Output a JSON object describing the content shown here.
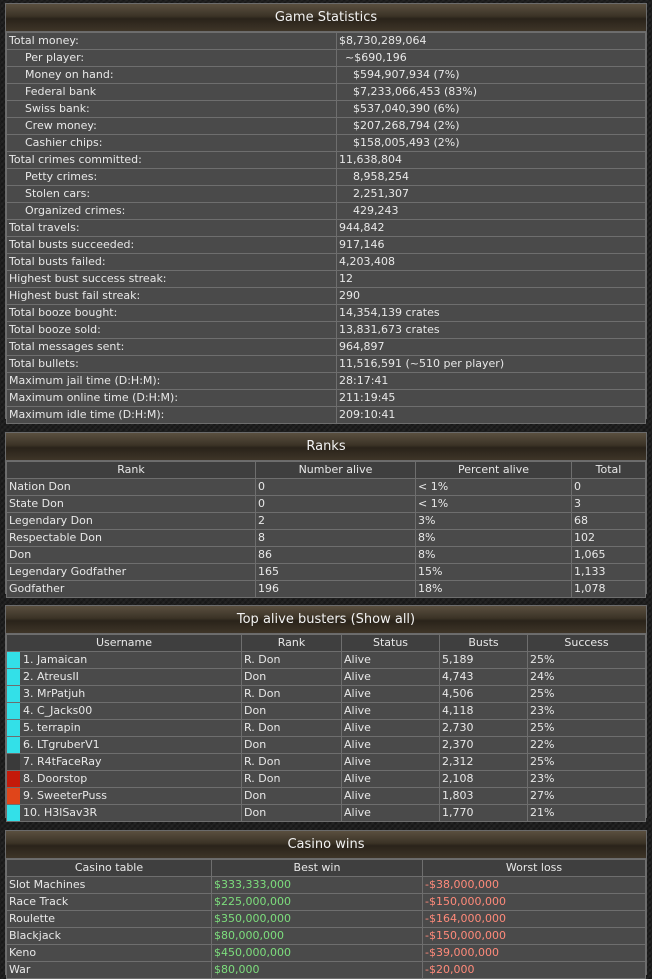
{
  "game_stats": {
    "title": "Game Statistics",
    "rows": [
      {
        "label": "Total money:",
        "value": "$8,730,289,064",
        "li": 0,
        "vi": 0
      },
      {
        "label": "Per player:",
        "value": "~$690,196",
        "li": 1,
        "vi": 1
      },
      {
        "label": "Money on hand:",
        "value": "$594,907,934 (7%)",
        "li": 1,
        "vi": 2
      },
      {
        "label": "Federal bank",
        "value": "$7,233,066,453 (83%)",
        "li": 1,
        "vi": 2
      },
      {
        "label": "Swiss bank:",
        "value": "$537,040,390 (6%)",
        "li": 1,
        "vi": 2
      },
      {
        "label": "Crew money:",
        "value": "$207,268,794 (2%)",
        "li": 1,
        "vi": 2
      },
      {
        "label": "Cashier chips:",
        "value": "$158,005,493 (2%)",
        "li": 1,
        "vi": 2
      },
      {
        "label": "Total crimes committed:",
        "value": "11,638,804",
        "li": 0,
        "vi": 0
      },
      {
        "label": "Petty crimes:",
        "value": "8,958,254",
        "li": 1,
        "vi": 2
      },
      {
        "label": "Stolen cars:",
        "value": "2,251,307",
        "li": 1,
        "vi": 2
      },
      {
        "label": "Organized crimes:",
        "value": "429,243",
        "li": 1,
        "vi": 2
      },
      {
        "label": "Total travels:",
        "value": "944,842",
        "li": 0,
        "vi": 0
      },
      {
        "label": "Total busts succeeded:",
        "value": "917,146",
        "li": 0,
        "vi": 0
      },
      {
        "label": "Total busts failed:",
        "value": "4,203,408",
        "li": 0,
        "vi": 0
      },
      {
        "label": "Highest bust success streak:",
        "value": "12",
        "li": 0,
        "vi": 0
      },
      {
        "label": "Highest bust fail streak:",
        "value": "290",
        "li": 0,
        "vi": 0
      },
      {
        "label": "Total booze bought:",
        "value": "14,354,139 crates",
        "li": 0,
        "vi": 0
      },
      {
        "label": "Total booze sold:",
        "value": "13,831,673 crates",
        "li": 0,
        "vi": 0
      },
      {
        "label": "Total messages sent:",
        "value": "964,897",
        "li": 0,
        "vi": 0
      },
      {
        "label": "Total bullets:",
        "value": "11,516,591 (~510 per player)",
        "li": 0,
        "vi": 0
      },
      {
        "label": "Maximum jail time (D:H:M):",
        "value": "28:17:41",
        "li": 0,
        "vi": 0
      },
      {
        "label": "Maximum online time (D:H:M):",
        "value": "211:19:45",
        "li": 0,
        "vi": 0
      },
      {
        "label": "Maximum idle time (D:H:M):",
        "value": "209:10:41",
        "li": 0,
        "vi": 0
      }
    ]
  },
  "ranks": {
    "title": "Ranks",
    "headers": [
      "Rank",
      "Number alive",
      "Percent alive",
      "Total"
    ],
    "rows": [
      [
        "Nation Don",
        "0",
        "< 1%",
        "0"
      ],
      [
        "State Don",
        "0",
        "< 1%",
        "3"
      ],
      [
        "Legendary Don",
        "2",
        "3%",
        "68"
      ],
      [
        "Respectable Don",
        "8",
        "8%",
        "102"
      ],
      [
        "Don",
        "86",
        "8%",
        "1,065"
      ],
      [
        "Legendary Godfather",
        "165",
        "15%",
        "1,133"
      ],
      [
        "Godfather",
        "196",
        "18%",
        "1,078"
      ]
    ]
  },
  "busters": {
    "title": "Top alive busters (Show all)",
    "headers": [
      "Username",
      "Rank",
      "Status",
      "Busts",
      "Success"
    ],
    "rows": [
      {
        "color": "#33e0e8",
        "user": "1. Jamaican",
        "rank": "R. Don",
        "status": "Alive",
        "busts": "5,189",
        "success": "25%"
      },
      {
        "color": "#33e0e8",
        "user": "2. AtreusII",
        "rank": "Don",
        "status": "Alive",
        "busts": "4,743",
        "success": "24%"
      },
      {
        "color": "#33e0e8",
        "user": "3. MrPatjuh",
        "rank": "R. Don",
        "status": "Alive",
        "busts": "4,506",
        "success": "25%"
      },
      {
        "color": "#33e0e8",
        "user": "4. C_Jacks00",
        "rank": "Don",
        "status": "Alive",
        "busts": "4,118",
        "success": "23%"
      },
      {
        "color": "#33e0e8",
        "user": "5. terrapin",
        "rank": "R. Don",
        "status": "Alive",
        "busts": "2,730",
        "success": "25%"
      },
      {
        "color": "#33e0e8",
        "user": "6. LTgruberV1",
        "rank": "Don",
        "status": "Alive",
        "busts": "2,370",
        "success": "22%"
      },
      {
        "color": "#3a3a3a",
        "user": "7. R4tFaceRay",
        "rank": "R. Don",
        "status": "Alive",
        "busts": "2,312",
        "success": "25%"
      },
      {
        "color": "#c41a0a",
        "user": "8. Doorstop",
        "rank": "R. Don",
        "status": "Alive",
        "busts": "2,108",
        "success": "23%"
      },
      {
        "color": "#e0451a",
        "user": "9. SweeterPuss",
        "rank": "Don",
        "status": "Alive",
        "busts": "1,803",
        "success": "27%"
      },
      {
        "color": "#33e0e8",
        "user": "10. H3lSav3R",
        "rank": "Don",
        "status": "Alive",
        "busts": "1,770",
        "success": "21%"
      }
    ]
  },
  "casino": {
    "title": "Casino wins",
    "headers": [
      "Casino table",
      "Best win",
      "Worst loss"
    ],
    "rows": [
      [
        "Slot Machines",
        "$333,333,000",
        "-$38,000,000"
      ],
      [
        "Race Track",
        "$225,000,000",
        "-$150,000,000"
      ],
      [
        "Roulette",
        "$350,000,000",
        "-$164,000,000"
      ],
      [
        "Blackjack",
        "$80,000,000",
        "-$150,000,000"
      ],
      [
        "Keno",
        "$450,000,000",
        "-$39,000,000"
      ],
      [
        "War",
        "$80,000",
        "-$20,000"
      ]
    ]
  }
}
